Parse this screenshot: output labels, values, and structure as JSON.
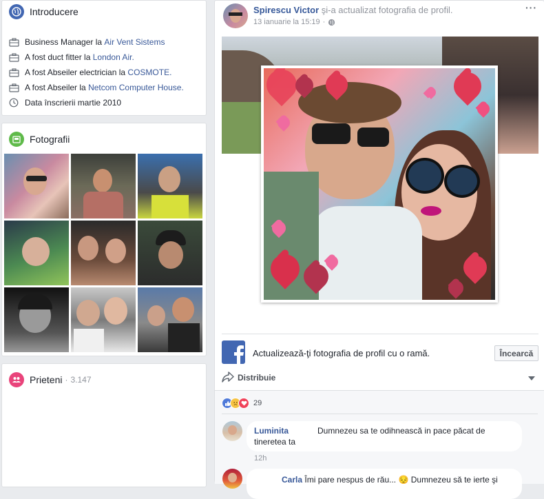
{
  "intro": {
    "title": "Introducere",
    "items": [
      {
        "prefix": "Business Manager la ",
        "link": "Air Vent Sistems"
      },
      {
        "prefix": "A fost duct fitter la ",
        "link": "London Air."
      },
      {
        "prefix": "A fost Abseiler electrician la ",
        "link": "COSMOTE."
      },
      {
        "prefix": "A fost Abseiler la ",
        "link": "Netcom Computer House."
      }
    ],
    "joined": "Data înscrierii martie 2010"
  },
  "photos": {
    "title": "Fotografii"
  },
  "friends": {
    "title": "Prieteni",
    "count": "3.147"
  },
  "post": {
    "author": "Spirescu Victor",
    "action": " şi-a actualizat fotografia de profil.",
    "date": "13 ianuarie la 15:19",
    "dot": "·",
    "more": "···",
    "frame_text": "Actualizează-ţi fotografia de profil cu o ramă.",
    "try_button": "Încearcă",
    "share": "Distribuie",
    "reaction_count": "29"
  },
  "comments": [
    {
      "name": "Luminita",
      "text": "Dumnezeu sa te odihnească in pace păcat de tineretea ta",
      "time": "12h"
    },
    {
      "name": "Carla",
      "text": "Îmi pare nespus de rău... 😔 Dumnezeu să te ierte şi"
    }
  ],
  "colors": {
    "fb_blue": "#4267b2",
    "link": "#385898",
    "intro_icon": "#4267b2",
    "photos_icon": "#5fba4a",
    "friends_icon": "#e9447b"
  }
}
